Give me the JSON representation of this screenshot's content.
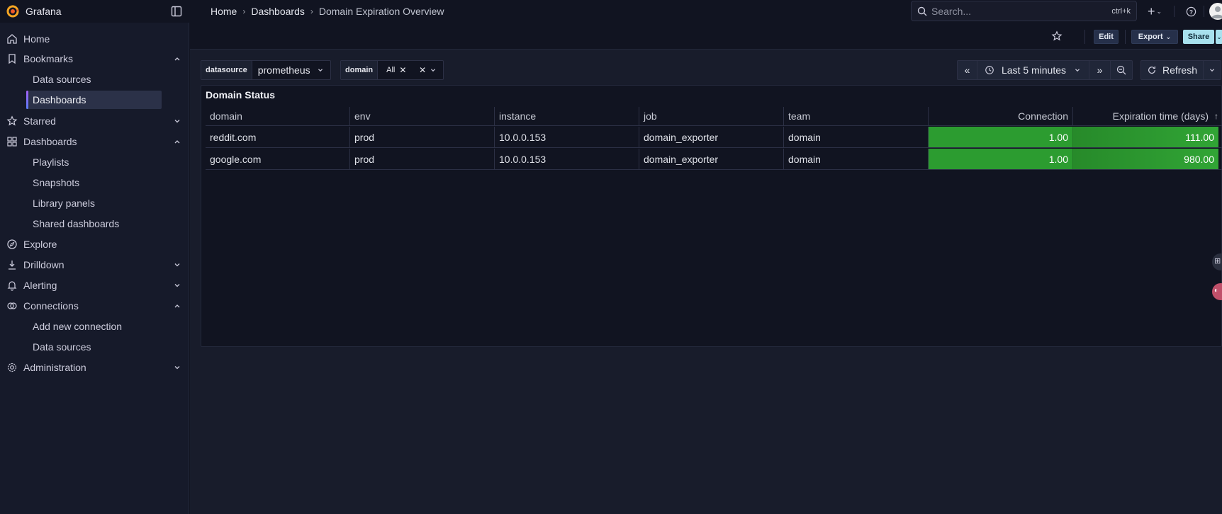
{
  "app": {
    "brand": "Grafana"
  },
  "breadcrumb": {
    "items": [
      "Home",
      "Dashboards",
      "Domain Expiration Overview"
    ]
  },
  "search": {
    "placeholder": "Search...",
    "shortcut": "ctrl+k"
  },
  "sidebar": {
    "items": [
      {
        "label": "Home",
        "icon": "home-icon"
      },
      {
        "label": "Bookmarks",
        "icon": "bookmark-icon",
        "expanded": true,
        "children": [
          "Data sources",
          "Dashboards"
        ]
      },
      {
        "label": "Starred",
        "icon": "star-icon",
        "expanded": false
      },
      {
        "label": "Dashboards",
        "icon": "apps-icon",
        "expanded": true,
        "children": [
          "Playlists",
          "Snapshots",
          "Library panels",
          "Shared dashboards"
        ]
      },
      {
        "label": "Explore",
        "icon": "compass-icon"
      },
      {
        "label": "Drilldown",
        "icon": "drilldown-icon",
        "expanded": false
      },
      {
        "label": "Alerting",
        "icon": "bell-icon",
        "expanded": false
      },
      {
        "label": "Connections",
        "icon": "connections-icon",
        "expanded": true,
        "children": [
          "Add new connection",
          "Data sources"
        ]
      },
      {
        "label": "Administration",
        "icon": "cog-icon",
        "expanded": false
      }
    ],
    "active": "Bookmarks/Dashboards"
  },
  "toolbar": {
    "edit_label": "Edit",
    "export_label": "Export",
    "share_label": "Share"
  },
  "variables": {
    "datasource": {
      "label": "datasource",
      "value": "prometheus"
    },
    "domain": {
      "label": "domain",
      "value": "All"
    }
  },
  "time_picker": {
    "range": "Last 5 minutes",
    "refresh_label": "Refresh"
  },
  "panel": {
    "title": "Domain Status",
    "columns": [
      "domain",
      "env",
      "instance",
      "job",
      "team",
      "Connection",
      "Expiration time (days)"
    ],
    "sort_indicator": "↑",
    "rows": [
      [
        "reddit.com",
        "prod",
        "10.0.0.153",
        "domain_exporter",
        "domain",
        "1.00",
        "111.00"
      ],
      [
        "google.com",
        "prod",
        "10.0.0.153",
        "domain_exporter",
        "domain",
        "1.00",
        "980.00"
      ]
    ],
    "value_cell_color": "#2c9c30"
  },
  "colors": {
    "bg": "#111421",
    "sidebar_bg": "#161a2a",
    "accent_share": "#a8e1ee",
    "active_indicator": "#a360f5"
  }
}
